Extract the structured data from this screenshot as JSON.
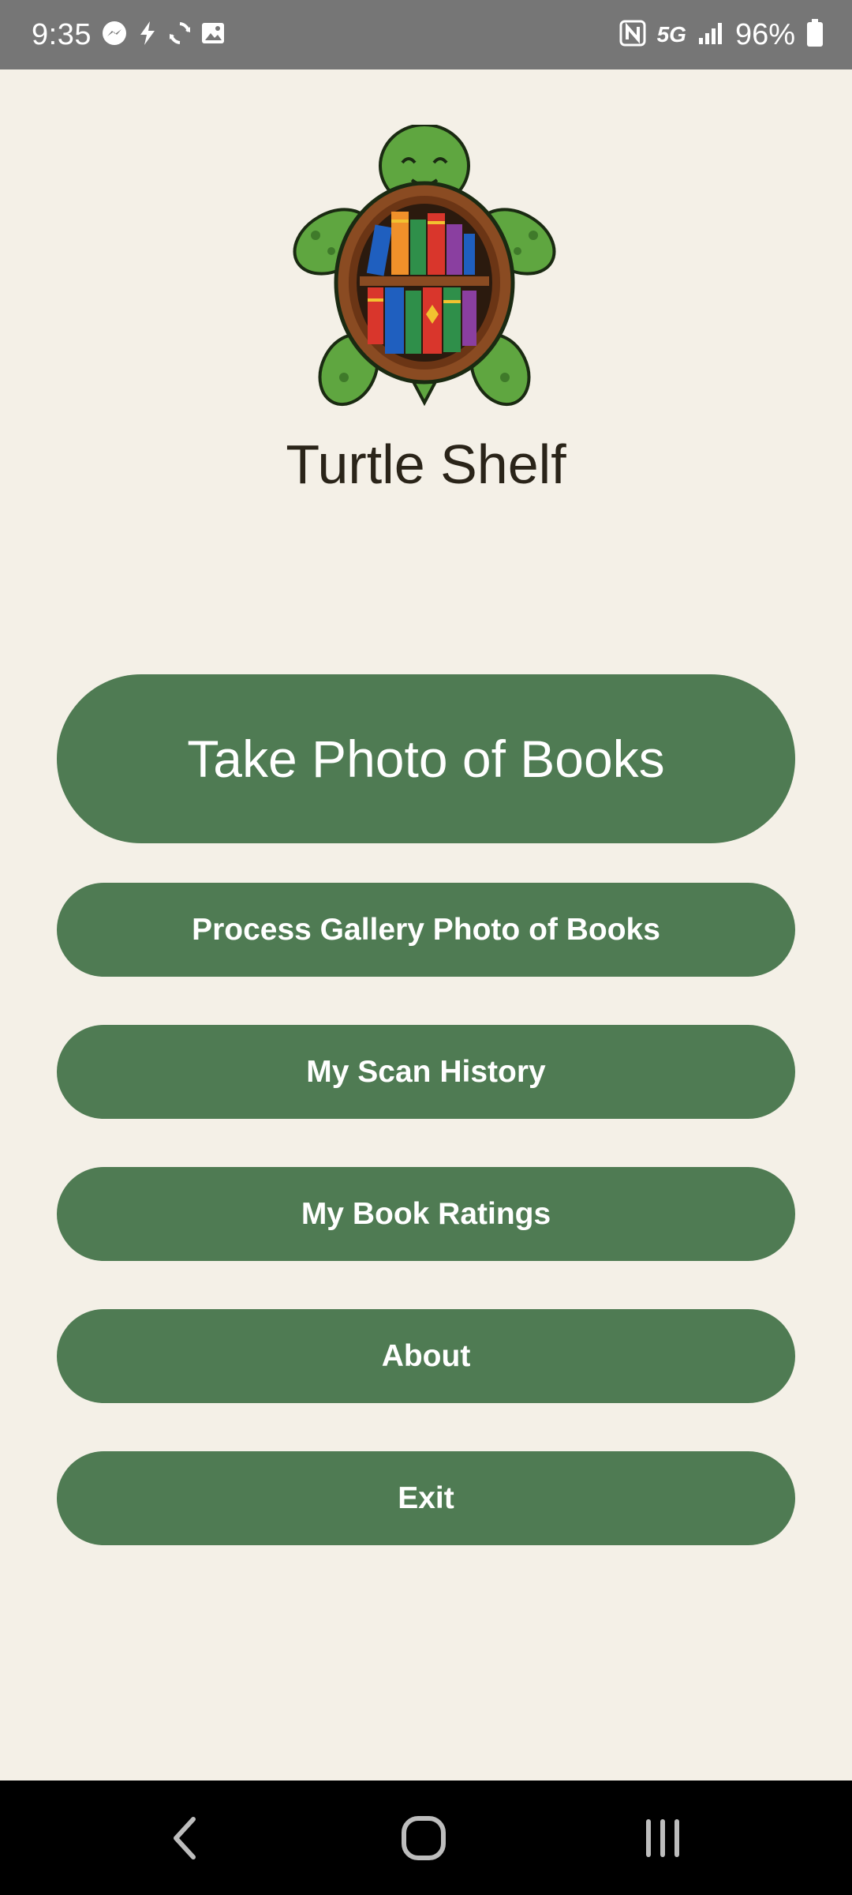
{
  "status_bar": {
    "time": "9:35",
    "battery_percent": "96%",
    "network": "5G",
    "left_icons": [
      "messenger-icon",
      "bolt-icon",
      "sync-icon",
      "image-icon"
    ],
    "right_icons": [
      "nfc-icon",
      "5g-icon",
      "signal-icon",
      "battery-icon"
    ]
  },
  "app": {
    "title": "Turtle Shelf",
    "logo": "turtle-bookshelf-logo"
  },
  "buttons": {
    "take_photo": "Take Photo of Books",
    "process_gallery": "Process Gallery Photo of Books",
    "scan_history": "My Scan History",
    "book_ratings": "My Book Ratings",
    "about": "About",
    "exit": "Exit"
  },
  "nav": {
    "icons": [
      "back-icon",
      "home-icon",
      "recents-icon"
    ]
  },
  "colors": {
    "background": "#f4f0e7",
    "button": "#4f7b53",
    "status_bar": "#767676",
    "nav_bar": "#000000"
  }
}
